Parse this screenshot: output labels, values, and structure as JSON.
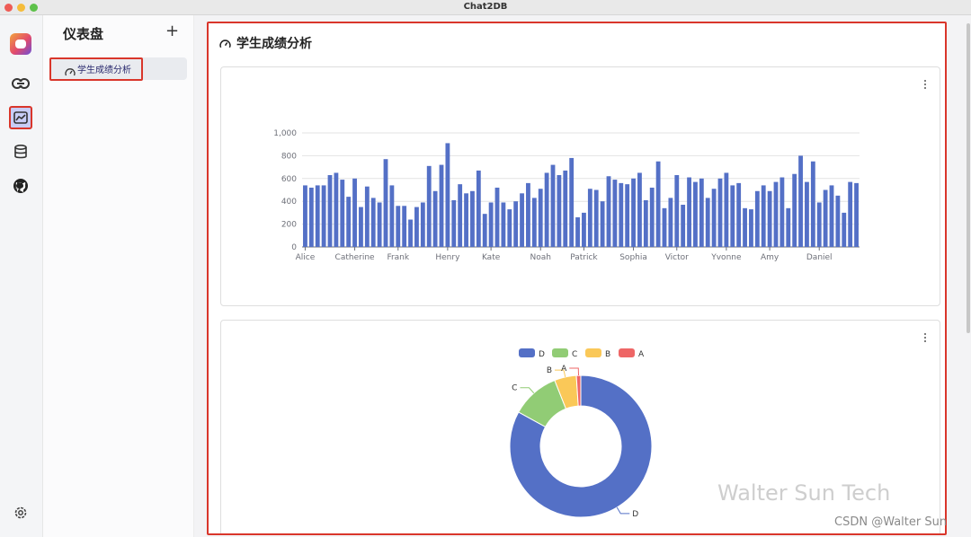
{
  "window": {
    "title": "Chat2DB"
  },
  "rail": {
    "items": [
      {
        "name": "link-icon"
      },
      {
        "name": "dashboard-icon",
        "active": true
      },
      {
        "name": "database-icon"
      },
      {
        "name": "github-icon"
      }
    ],
    "settings": {
      "name": "settings-icon"
    }
  },
  "sidebar": {
    "title": "仪表盘",
    "add_label": "+",
    "items": [
      {
        "label": "学生成绩分析",
        "icon": "gauge-icon"
      }
    ]
  },
  "main": {
    "title": "学生成绩分析",
    "title_icon": "gauge-icon"
  },
  "colors": {
    "bar": "#5470c6",
    "D": "#5470c6",
    "C": "#91cc75",
    "B": "#fac858",
    "A": "#ee6666",
    "highlight": "#d9362b"
  },
  "chart_data": [
    {
      "type": "bar",
      "ylim": [
        0,
        1000
      ],
      "yticks": [
        "0",
        "200",
        "400",
        "600",
        "800",
        "1,000"
      ],
      "tick_labels": [
        "Alice",
        "Catherine",
        "Frank",
        "Henry",
        "Kate",
        "Noah",
        "Patrick",
        "Sophia",
        "Victor",
        "Yvonne",
        "Amy",
        "Daniel"
      ],
      "values": [
        540,
        520,
        540,
        540,
        630,
        650,
        590,
        440,
        600,
        350,
        530,
        430,
        390,
        770,
        540,
        360,
        360,
        240,
        350,
        390,
        710,
        490,
        720,
        910,
        410,
        550,
        470,
        490,
        670,
        290,
        390,
        520,
        390,
        330,
        400,
        470,
        560,
        430,
        510,
        650,
        720,
        630,
        670,
        780,
        260,
        300,
        510,
        500,
        400,
        620,
        590,
        560,
        550,
        600,
        650,
        410,
        520,
        750,
        340,
        430,
        630,
        370,
        610,
        570,
        600,
        430,
        510,
        600,
        650,
        540,
        560,
        340,
        330,
        490,
        540,
        490,
        570,
        610,
        340,
        640,
        800,
        570,
        750,
        390,
        500,
        540,
        450,
        300,
        570,
        560
      ]
    },
    {
      "type": "pie",
      "legend": [
        "D",
        "C",
        "B",
        "A"
      ],
      "labels": [
        "D",
        "C",
        "B",
        "A"
      ],
      "values": [
        83,
        11,
        5,
        1
      ]
    }
  ],
  "watermark": "Walter Sun Tech",
  "csdn": "CSDN @Walter Sun"
}
